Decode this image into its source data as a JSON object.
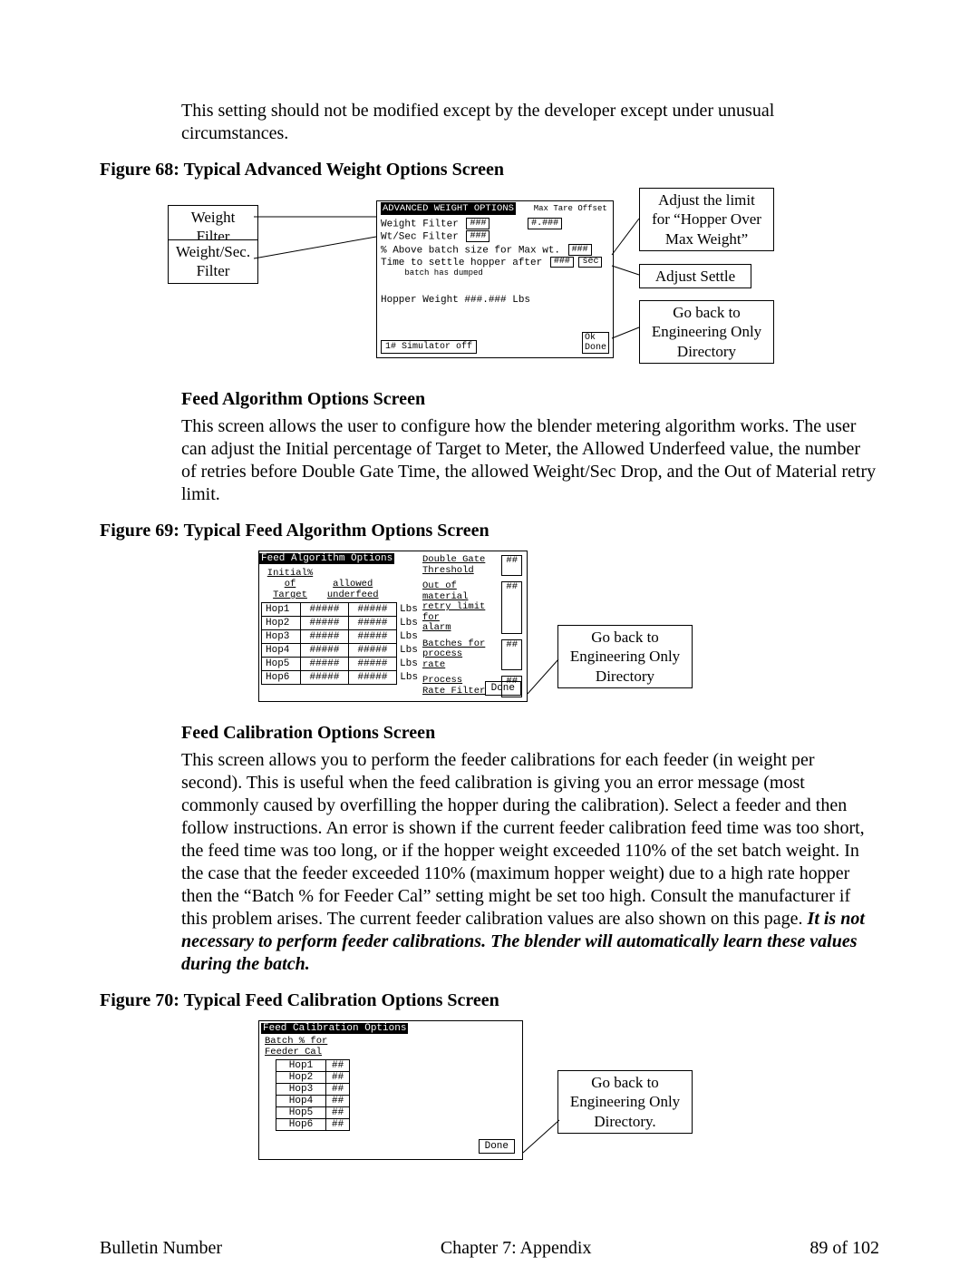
{
  "intro_para": "This setting should not be modified except by the developer except under unusual circumstances.",
  "fig68": {
    "caption": "Figure 68: Typical Advanced Weight Options Screen",
    "callouts": {
      "weight_filter": "Weight Filter",
      "wt_sec_filter_l1": "Weight/Sec.",
      "wt_sec_filter_l2": "Filter",
      "adjust_limit_l1": "Adjust the limit",
      "adjust_limit_l2": "for “Hopper Over",
      "adjust_limit_l3": "Max Weight”",
      "adjust_settle": "Adjust Settle",
      "goback_l1": "Go back to",
      "goback_l2": "Engineering Only",
      "goback_l3": "Directory"
    },
    "screen": {
      "title": "ADVANCED WEIGHT OPTIONS",
      "max_tare_label": "Max Tare Offset",
      "max_tare_val": "#.###",
      "weight_filter_label": "Weight Filter",
      "weight_filter_val": "###",
      "wtsec_label": "Wt/Sec Filter",
      "wtsec_val": "###",
      "above_label": "% Above batch size for Max wt.",
      "above_val": "###",
      "settle_label_l1": "Time to settle hopper after",
      "settle_label_l2": "batch has dumped",
      "settle_val1": "###",
      "settle_val2": "sec",
      "hopper_weight": "Hopper Weight   ###.###  Lbs",
      "sim_button": "1# Simulator off",
      "done_line1": "Ok",
      "done_line2": "Done"
    }
  },
  "feed_algo": {
    "heading": "Feed Algorithm Options Screen",
    "para": "This screen allows the user to configure how the blender metering algorithm works.  The user can adjust the Initial percentage of Target to Meter, the Allowed Underfeed value, the number of retries before Double Gate Time, the allowed Weight/Sec Drop, and the Out of Material retry limit."
  },
  "fig69": {
    "caption": "Figure 69: Typical Feed Algorithm Options Screen",
    "screen_title": "Feed Algorithm Options",
    "col1": "Initial% of\nTarget",
    "col2": "allowed\nunderfeed",
    "hops": [
      "Hop1",
      "Hop2",
      "Hop3",
      "Hop4",
      "Hop5",
      "Hop6"
    ],
    "val": "#####",
    "unit": "Lbs",
    "right": {
      "double_gate": "Double Gate\nThreshold",
      "double_gate_val": "##",
      "out_mat": "Out of material\nretry limit for\nalarm",
      "out_mat_val": "##",
      "batches": "Batches for\nprocess\nrate",
      "batches_val": "##",
      "proc_rate": "Process\nRate Filter",
      "proc_rate_val": "##"
    },
    "done": "Done",
    "callout_l1": "Go back to",
    "callout_l2": "Engineering Only",
    "callout_l3": "Directory"
  },
  "feed_cal": {
    "heading": "Feed Calibration Options Screen",
    "para_plain": "This screen allows you to perform the feeder calibrations for each feeder (in weight per second).  This is useful when the feed calibration is giving you an error message (most commonly caused by overfilling the hopper during the calibration).  Select a feeder and then follow instructions.  An error is shown if the current feeder calibration feed time was too short, the feed time was too long, or if the hopper weight exceeded 110% of the set batch weight.  In the case that the feeder exceeded 110% (maximum hopper weight) due to a high rate hopper then the “Batch % for Feeder Cal” setting might be set too high.  Consult the manufacturer if this problem arises.  The current feeder calibration values are also shown on this page.  ",
    "para_emph": "It is not necessary to perform feeder calibrations.  The blender will automatically learn these values during the batch."
  },
  "fig70": {
    "caption": "Figure 70: Typical Feed Calibration Options Screen",
    "screen_title": "Feed Calibration Options",
    "subhead": "Batch % for\nFeeder Cal",
    "hops": [
      "Hop1",
      "Hop2",
      "Hop3",
      "Hop4",
      "Hop5",
      "Hop6"
    ],
    "val": "##",
    "done": "Done",
    "callout_l1": "Go back to",
    "callout_l2": "Engineering Only",
    "callout_l3": "Directory."
  },
  "footer": {
    "left": "Bulletin Number",
    "center": "Chapter 7: Appendix",
    "right": "89 of 102"
  }
}
